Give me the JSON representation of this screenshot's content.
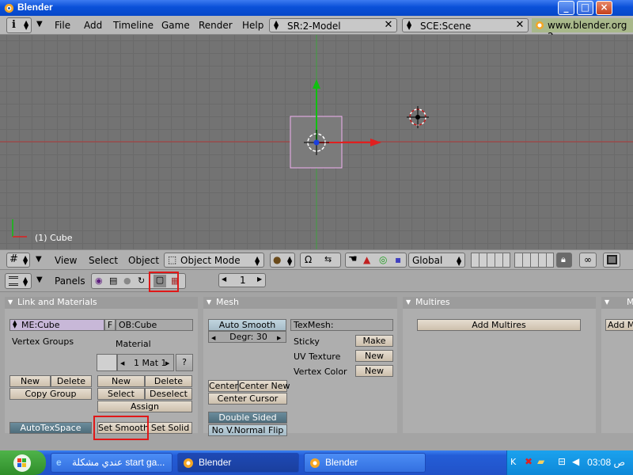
{
  "window": {
    "title": "Blender",
    "controls": [
      "_",
      "□",
      "×"
    ]
  },
  "top_header": {
    "menus": [
      "File",
      "Add",
      "Timeline",
      "Game",
      "Render",
      "Help"
    ],
    "screen_select": "SR:2-Model",
    "scene_select": "SCE:Scene",
    "url": "www.blender.org 2"
  },
  "viewport": {
    "object_label": "(1) Cube"
  },
  "view_header": {
    "menus": [
      "View",
      "Select",
      "Object"
    ],
    "mode": "Object Mode",
    "orientation": "Global"
  },
  "buttons_header": {
    "panels_label": "Panels",
    "frame_value": "1"
  },
  "panels": {
    "link_materials": {
      "title": "Link and Materials",
      "me_field": "ME:Cube",
      "f_btn": "F",
      "ob_field": "OB:Cube",
      "vertex_groups": "Vertex Groups",
      "material": "Material",
      "mat_value": "1 Mat 1",
      "help": "?",
      "new": "New",
      "delete": "Delete",
      "copy_group": "Copy Group",
      "new2": "New",
      "delete2": "Delete",
      "select": "Select",
      "deselect": "Deselect",
      "assign": "Assign",
      "autotexspace": "AutoTexSpace",
      "set_smooth": "Set Smooth",
      "set_solid": "Set Solid"
    },
    "mesh": {
      "title": "Mesh",
      "auto_smooth": "Auto Smooth",
      "degr": "Degr: 30",
      "texmesh": "TexMesh:",
      "sticky": "Sticky",
      "make": "Make",
      "uv_texture": "UV Texture",
      "new_uv": "New",
      "vertex_color": "Vertex Color",
      "new_vc": "New",
      "center": "Center",
      "center_new": "Center New",
      "center_cursor": "Center Cursor",
      "double_sided": "Double Sided",
      "no_vnormal_flip": "No V.Normal Flip"
    },
    "multires": {
      "title": "Multires",
      "add_multires": "Add Multires"
    },
    "extra": {
      "title": "M",
      "add_btn": "Add M"
    }
  },
  "taskbar": {
    "tasks": [
      "عندي مشكلة start ga...",
      "Blender",
      "Blender"
    ],
    "time": "ص 03:08"
  }
}
